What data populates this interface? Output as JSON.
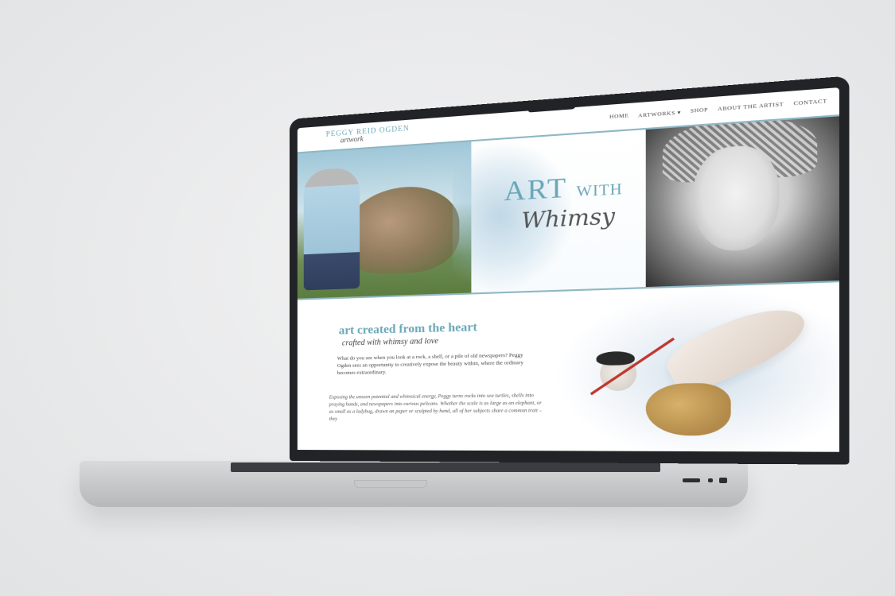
{
  "site": {
    "logo_name": "PEGGY REID OGDEN",
    "logo_sub": "artwork",
    "nav": [
      "HOME",
      "ARTWORKS ▾",
      "SHOP",
      "ABOUT THE ARTIST",
      "CONTACT"
    ]
  },
  "hero": {
    "title_art": "ART",
    "title_with": "WITH",
    "title_script": "Whimsy"
  },
  "intro": {
    "heading": "art created from the heart",
    "subheading": "crafted with whimsy and love",
    "paragraph1": "What do you see when you look at a rock, a shell, or a pile of old newspapers? Peggy Ogden sees an opportunity to creatively expose the beauty within, where the ordinary becomes extraordinary.",
    "paragraph2": "Exposing the unseen potential and whimsical energy, Peggy turns rocks into sea turtles, shells into praying hands, and newspapers into curious pelicans. Whether the scale is as large as an elephant, or as small as a ladybug, drawn on paper or sculpted by hand, all of her subjects share a common trait – they"
  },
  "colors": {
    "accent": "#6aa7b8",
    "bezel": "#222326"
  }
}
